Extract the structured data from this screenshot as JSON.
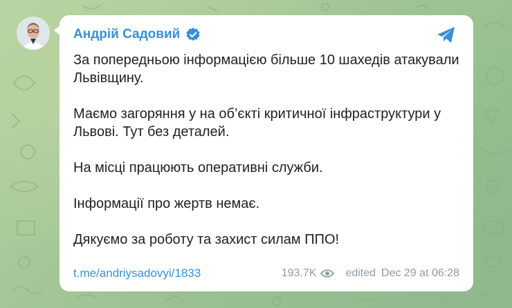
{
  "channel_post": {
    "author": "Андрій Садовий",
    "verified_icon": "verified-check-icon",
    "share_icon": "telegram-share-icon",
    "paragraphs": [
      "За попередньою інформацією більше 10 шахедів атакували Львівщину.",
      "Маємо загоряння у на об’єкті критичної інфраструктури у Львові. Тут без деталей.",
      "На місці працюють оперативні служби.",
      "Інформації про жертв немає.",
      "Дякуємо за роботу та захист силам ППО!"
    ],
    "link": "t.me/andriysadovyi/1833",
    "views": "193.7K",
    "views_icon": "eye-icon",
    "edited": "edited",
    "timestamp": "Dec 29 at 06:28"
  },
  "colors": {
    "accent": "#3a8fd6",
    "bubble": "#ffffff",
    "text": "#1f1f1f",
    "meta": "#8d9ba3",
    "background": "#a7c79a"
  }
}
